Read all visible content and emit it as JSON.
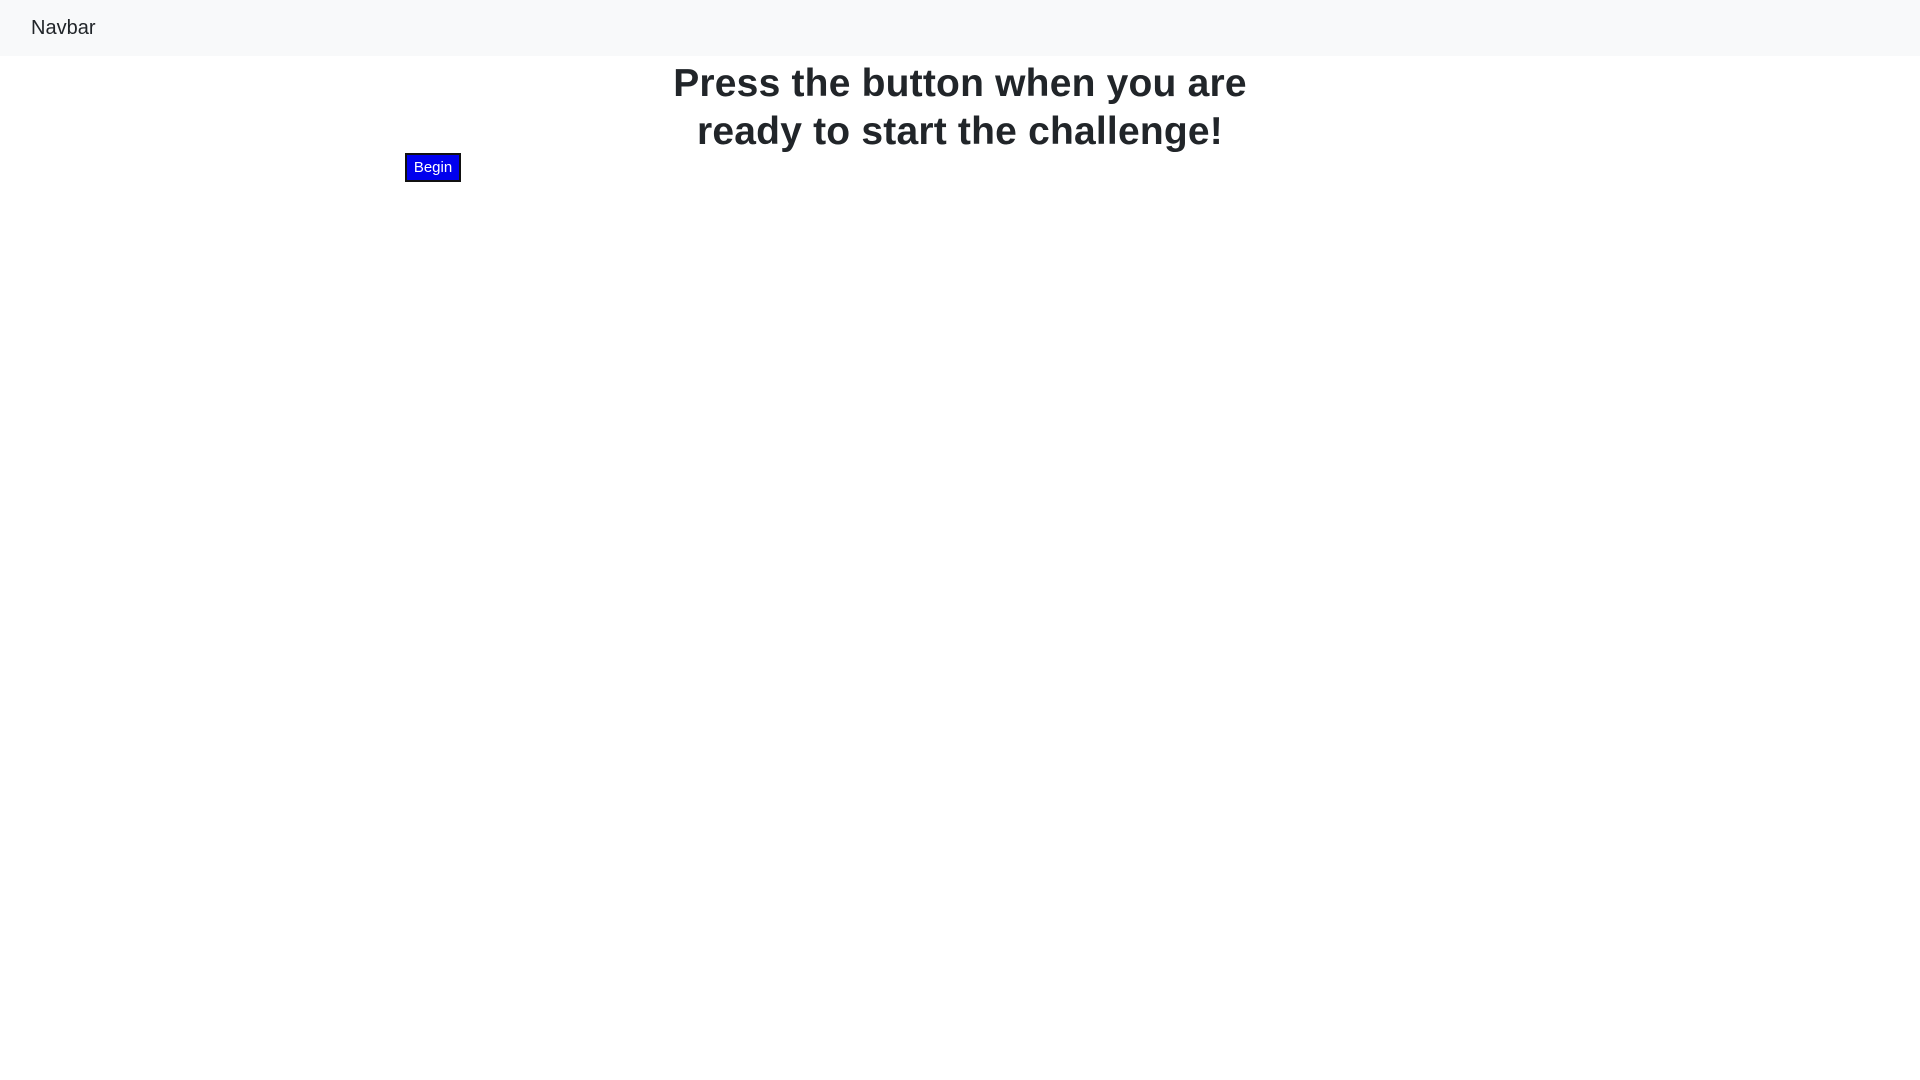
{
  "navbar": {
    "brand_label": "Navbar"
  },
  "main": {
    "heading": "Press the button when you are ready to start the challenge!",
    "begin_button_label": "Begin"
  },
  "colors": {
    "navbar_background": "#f8f9fa",
    "heading_text": "#212529",
    "button_background": "#0000ee",
    "button_text": "#ffffff",
    "button_border": "#111111",
    "page_background": "#ffffff"
  }
}
